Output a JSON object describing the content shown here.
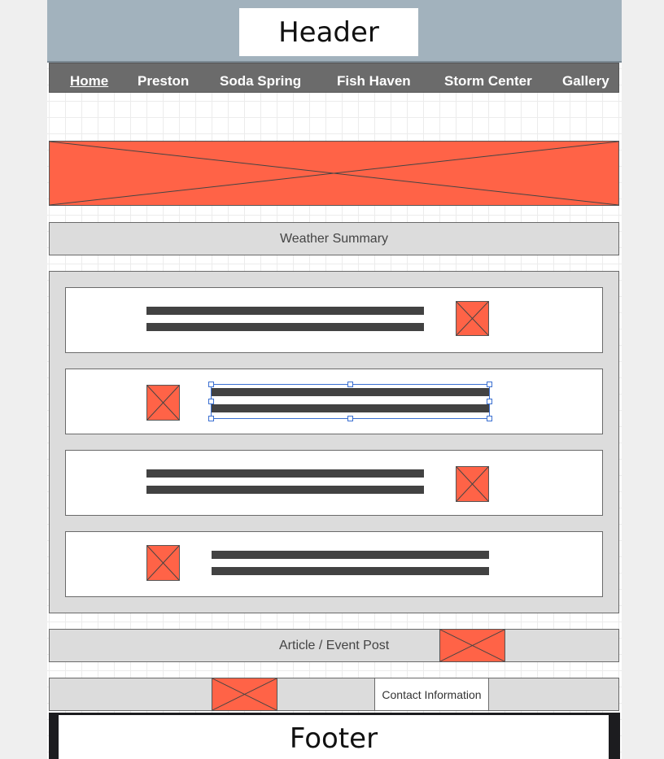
{
  "header": {
    "title": "Header"
  },
  "nav": {
    "items": [
      {
        "label": "Home",
        "active": true
      },
      {
        "label": "Preston"
      },
      {
        "label": "Soda Spring"
      },
      {
        "label": "Fish Haven"
      },
      {
        "label": "Storm Center"
      },
      {
        "label": "Gallery"
      }
    ]
  },
  "sections": {
    "weather_summary": "Weather Summary",
    "article_post": "Article / Event Post",
    "contact": "Contact Information"
  },
  "footer": {
    "title": "Footer"
  },
  "colors": {
    "header_band": "#a2b2bd",
    "nav_bar": "#6b6b6b",
    "image_placeholder": "#ff6347",
    "panel_gray": "#dcdcdc",
    "text_line": "#424242",
    "selection": "#3a6fd1",
    "footer_dark": "#1c1c1f"
  },
  "icons": {
    "image_placeholder": "image-placeholder-icon",
    "selection_handle": "resize-handle-icon"
  }
}
